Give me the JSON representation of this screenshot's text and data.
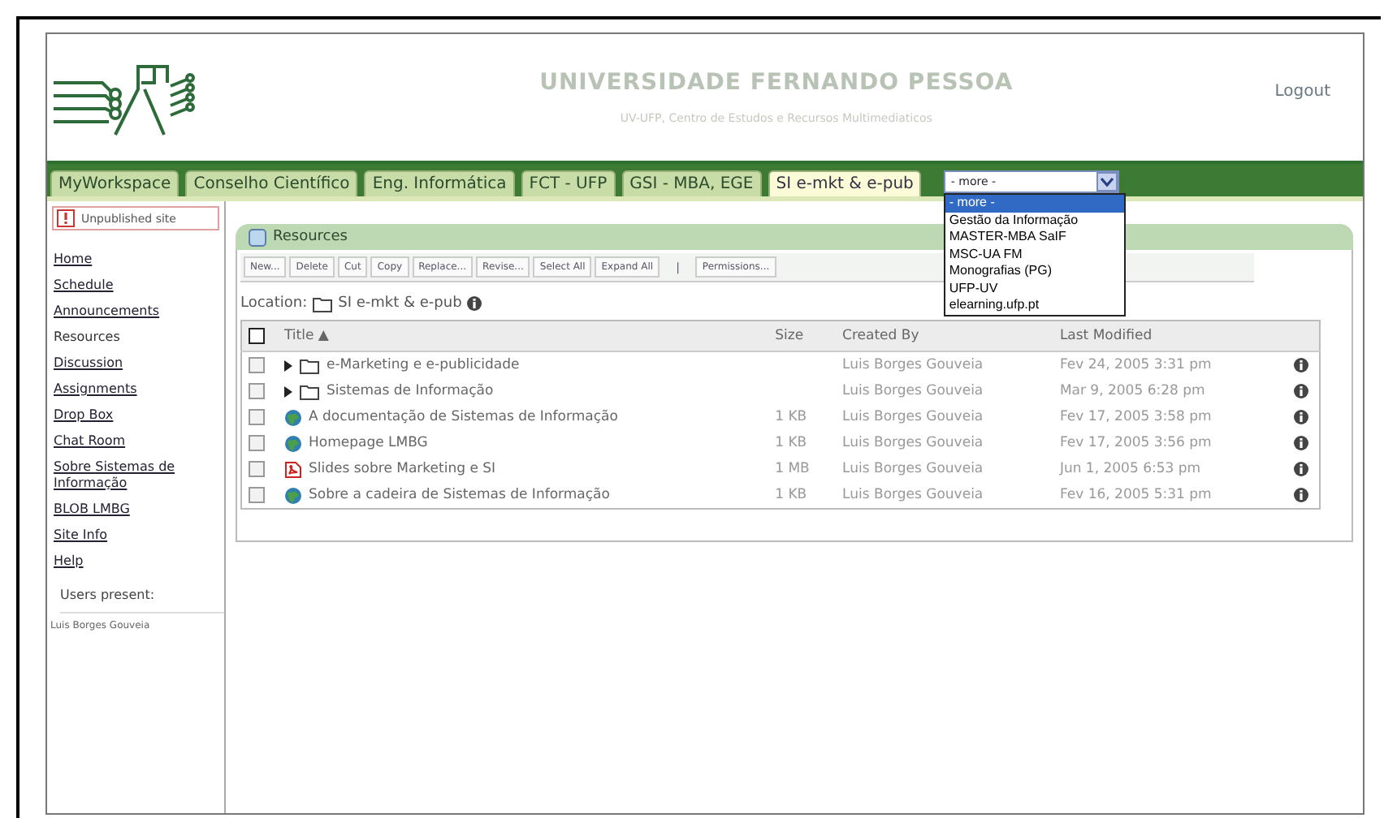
{
  "header": {
    "title": "UNIVERSIDADE FERNANDO PESSOA",
    "subtitle": "UV-UFP, Centro de Estudos e Recursos Multimediaticos",
    "logout": "Logout"
  },
  "tabs": [
    {
      "label": "MyWorkspace",
      "selected": false
    },
    {
      "label": "Conselho Científico",
      "selected": false
    },
    {
      "label": "Eng. Informática",
      "selected": false
    },
    {
      "label": "FCT - UFP",
      "selected": false
    },
    {
      "label": "GSI - MBA, EGE",
      "selected": false
    },
    {
      "label": "SI e-mkt & e-pub",
      "selected": true
    }
  ],
  "more_select": {
    "value": "- more -",
    "expanded": true,
    "options": [
      {
        "label": "- more -",
        "selected": true
      },
      {
        "label": "Gestão da Informação",
        "selected": false
      },
      {
        "label": "MASTER-MBA SaIF",
        "selected": false
      },
      {
        "label": "MSC-UA FM",
        "selected": false
      },
      {
        "label": "Monografias (PG)",
        "selected": false
      },
      {
        "label": "UFP-UV",
        "selected": false
      },
      {
        "label": "elearning.ufp.pt",
        "selected": false
      }
    ]
  },
  "sidebar": {
    "notice": "Unpublished site",
    "items": [
      {
        "label": "Home",
        "selected": false
      },
      {
        "label": "Schedule",
        "selected": false
      },
      {
        "label": "Announcements",
        "selected": false
      },
      {
        "label": "Resources",
        "selected": true
      },
      {
        "label": "Discussion",
        "selected": false
      },
      {
        "label": "Assignments",
        "selected": false
      },
      {
        "label": "Drop Box",
        "selected": false
      },
      {
        "label": "Chat Room",
        "selected": false
      },
      {
        "label": "Sobre Sistemas de Informação",
        "selected": false
      },
      {
        "label": "BLOB LMBG",
        "selected": false
      },
      {
        "label": "Site Info",
        "selected": false
      },
      {
        "label": "Help",
        "selected": false
      }
    ],
    "users_label": "Users present:",
    "users": [
      "Luis Borges Gouveia"
    ]
  },
  "panel": {
    "title": "Resources",
    "toolbar": [
      {
        "label": "New...",
        "kind": "button"
      },
      {
        "label": "Delete",
        "kind": "button"
      },
      {
        "label": "Cut",
        "kind": "button"
      },
      {
        "label": "Copy",
        "kind": "button"
      },
      {
        "label": "Replace...",
        "kind": "button"
      },
      {
        "label": "Revise...",
        "kind": "button"
      },
      {
        "label": "Select All",
        "kind": "button"
      },
      {
        "label": "Expand All",
        "kind": "button"
      },
      {
        "label": "|",
        "kind": "separator"
      },
      {
        "label": "Permissions...",
        "kind": "button"
      }
    ],
    "location_label": "Location:",
    "location": "SI e-mkt & e-pub",
    "table": {
      "select_all_checked": false,
      "columns": [
        "Title ▲",
        "Size",
        "Created By",
        "Last Modified"
      ],
      "rows": [
        {
          "kind": "folder",
          "checked": false,
          "title": "e-Marketing e e-publicidade",
          "size": "",
          "created_by": "Luis Borges Gouveia",
          "modified": "Fev 24, 2005 3:31 pm"
        },
        {
          "kind": "folder",
          "checked": false,
          "title": "Sistemas de Informação",
          "size": "",
          "created_by": "Luis Borges Gouveia",
          "modified": "Mar 9, 2005 6:28 pm"
        },
        {
          "kind": "web",
          "checked": false,
          "title": "A documentação de Sistemas de Informação",
          "size": "1 KB",
          "created_by": "Luis Borges Gouveia",
          "modified": "Fev 17, 2005 3:58 pm"
        },
        {
          "kind": "web",
          "checked": false,
          "title": "Homepage LMBG",
          "size": "1 KB",
          "created_by": "Luis Borges Gouveia",
          "modified": "Fev 17, 2005 3:56 pm"
        },
        {
          "kind": "pdf",
          "checked": false,
          "title": "Slides sobre Marketing e SI",
          "size": "1 MB",
          "created_by": "Luis Borges Gouveia",
          "modified": "Jun 1, 2005 6:53 pm"
        },
        {
          "kind": "web",
          "checked": false,
          "title": "Sobre a cadeira de Sistemas de Informação",
          "size": "1 KB",
          "created_by": "Luis Borges Gouveia",
          "modified": "Fev 16, 2005 5:31 pm"
        }
      ]
    }
  }
}
